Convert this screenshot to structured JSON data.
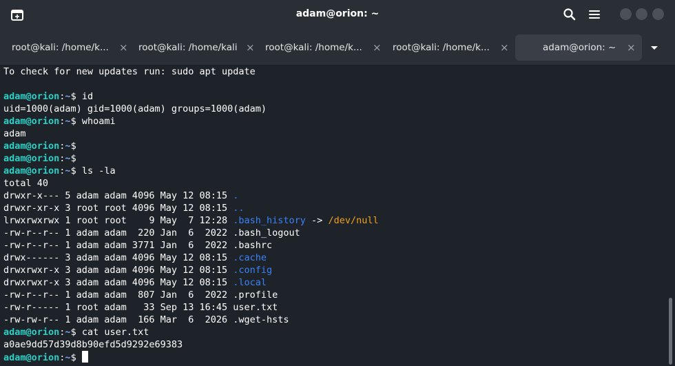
{
  "window": {
    "title": "adam@orion: ~"
  },
  "icons": {
    "new_tab": "new-tab-icon",
    "search": "search-icon",
    "menu": "hamburger-menu-icon"
  },
  "tabs": [
    {
      "label": "root@kali: /home/k...",
      "close": "×"
    },
    {
      "label": "root@kali: /home/kali",
      "close": "×"
    },
    {
      "label": "root@kali: /home/k...",
      "close": "×"
    },
    {
      "label": "root@kali: /home/k...",
      "close": "×"
    },
    {
      "label": "adam@orion: ~",
      "close": "×",
      "active": true
    }
  ],
  "terminal": {
    "lines": [
      {
        "type": "text",
        "text": "To check for new updates run: sudo apt update"
      },
      {
        "type": "text",
        "text": ""
      },
      {
        "type": "prompt",
        "user": "adam@orion",
        "path": "~",
        "cmd": " id"
      },
      {
        "type": "text",
        "text": "uid=1000(adam) gid=1000(adam) groups=1000(adam)"
      },
      {
        "type": "prompt",
        "user": "adam@orion",
        "path": "~",
        "cmd": " whoami"
      },
      {
        "type": "text",
        "text": "adam"
      },
      {
        "type": "prompt",
        "user": "adam@orion",
        "path": "~",
        "cmd": ""
      },
      {
        "type": "prompt",
        "user": "adam@orion",
        "path": "~",
        "cmd": ""
      },
      {
        "type": "prompt",
        "user": "adam@orion",
        "path": "~",
        "cmd": " ls -la"
      },
      {
        "type": "text",
        "text": "total 40"
      },
      {
        "type": "ls",
        "meta": "drwxr-x--- 5 adam adam 4096 May 12 08:15 ",
        "name": ".",
        "kind": "dir"
      },
      {
        "type": "ls",
        "meta": "drwxr-xr-x 3 root root 4096 May 12 08:15 ",
        "name": "..",
        "kind": "dir"
      },
      {
        "type": "ls",
        "meta": "lrwxrwxrwx 1 root root    9 May  7 12:28 ",
        "name": ".bash_history",
        "kind": "link",
        "arrow": " -> ",
        "target": "/dev/null"
      },
      {
        "type": "ls",
        "meta": "-rw-r--r-- 1 adam adam  220 Jan  6  2022 ",
        "name": ".bash_logout",
        "kind": "file"
      },
      {
        "type": "ls",
        "meta": "-rw-r--r-- 1 adam adam 3771 Jan  6  2022 ",
        "name": ".bashrc",
        "kind": "file"
      },
      {
        "type": "ls",
        "meta": "drwx------ 3 adam adam 4096 May 12 08:15 ",
        "name": ".cache",
        "kind": "dir"
      },
      {
        "type": "ls",
        "meta": "drwxrwxr-x 3 adam adam 4096 May 12 08:15 ",
        "name": ".config",
        "kind": "dir"
      },
      {
        "type": "ls",
        "meta": "drwxrwxr-x 3 adam adam 4096 May 12 08:15 ",
        "name": ".local",
        "kind": "dir"
      },
      {
        "type": "ls",
        "meta": "-rw-r--r-- 1 adam adam  807 Jan  6  2022 ",
        "name": ".profile",
        "kind": "file"
      },
      {
        "type": "ls",
        "meta": "-rw-r----- 1 root adam   33 Sep 13 16:45 ",
        "name": "user.txt",
        "kind": "file"
      },
      {
        "type": "ls",
        "meta": "-rw-rw-r-- 1 adam adam  166 Mar  6  2026 ",
        "name": ".wget-hsts",
        "kind": "file"
      },
      {
        "type": "prompt",
        "user": "adam@orion",
        "path": "~",
        "cmd": " cat user.txt"
      },
      {
        "type": "text",
        "text": "a0ae9dd57d39d8b90efd5d9292e69383"
      },
      {
        "type": "prompt",
        "user": "adam@orion",
        "path": "~",
        "cmd": " ",
        "cursor": true
      }
    ]
  },
  "colors": {
    "prompt_user": "#2bd0c6",
    "directory": "#3b82f6",
    "symlink_target": "#f0a020",
    "background": "#1e2329"
  }
}
